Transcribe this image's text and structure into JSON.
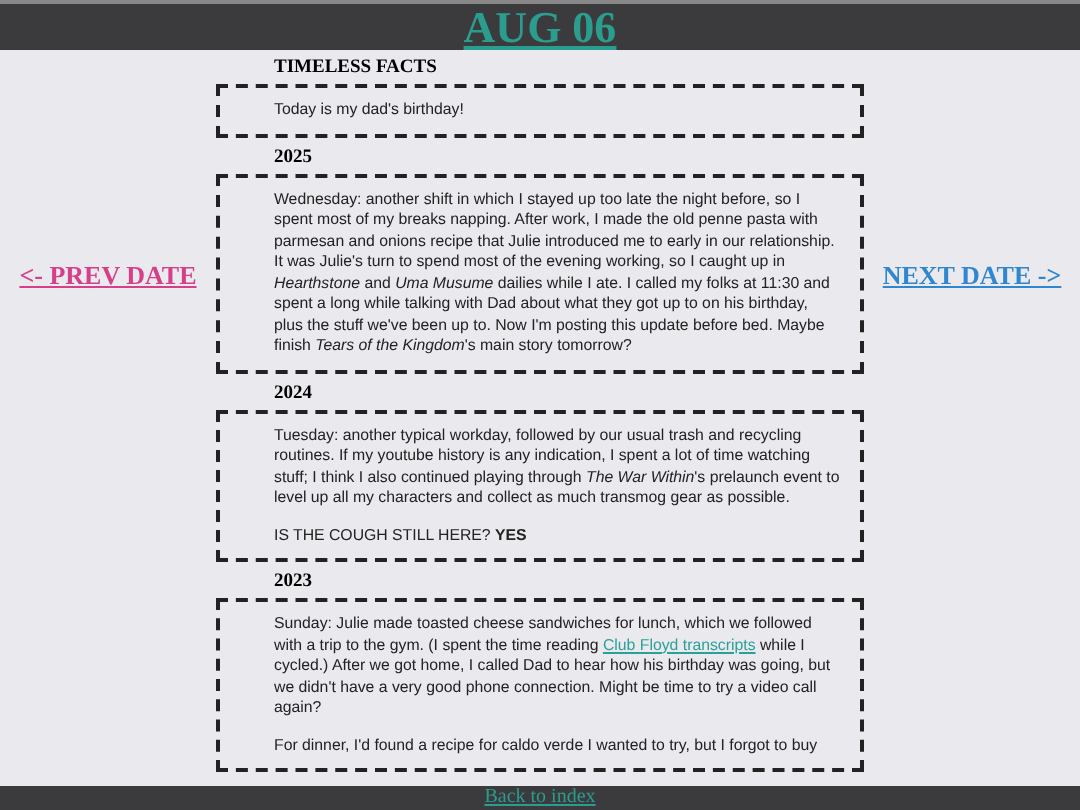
{
  "header": {
    "title": "AUG 06"
  },
  "nav": {
    "prev": "<- PREV DATE",
    "next": "NEXT DATE ->"
  },
  "sections": [
    {
      "heading": "TIMELESS FACTS",
      "paragraphs": [
        [
          {
            "kind": "text",
            "text": "Today is my dad's birthday!"
          }
        ]
      ]
    },
    {
      "heading": "2025",
      "paragraphs": [
        [
          {
            "kind": "text",
            "text": "Wednesday: another shift in which I stayed up too late the night before, so I spent most of my breaks napping. After work, I made the old penne pasta with parmesan and onions recipe that Julie introduced me to early in our relationship. It was Julie's turn to spend most of the evening working, so I caught up in *Hearthstone* and *Uma Musume* dailies while I ate. I called my folks at 11:30 and spent a long while talking with Dad about what they got up to on his birthday, plus the stuff we've been up to. Now I'm posting this update before bed. Maybe finish *Tears of the Kingdom*'s main story tomorrow?"
          }
        ]
      ]
    },
    {
      "heading": "2024",
      "paragraphs": [
        [
          {
            "kind": "text",
            "text": "Tuesday: another typical workday, followed by our usual trash and recycling routines. If my youtube history is any indication, I spent a lot of time watching stuff; I think I also continued playing through *The War Within*'s prelaunch event to level up all my characters and collect as much transmog gear as possible."
          }
        ],
        [
          {
            "kind": "text",
            "text": "IS THE COUGH STILL HERE? **YES**"
          }
        ]
      ]
    },
    {
      "heading": "2023",
      "paragraphs": [
        [
          {
            "kind": "text",
            "text": "Sunday: Julie made toasted cheese sandwiches for lunch, which we followed with a trip to the gym. (I spent the time reading "
          },
          {
            "kind": "link",
            "text": "Club Floyd transcripts"
          },
          {
            "kind": "text",
            "text": " while I cycled.) After we got home, I called Dad to hear how his birthday was going, but we didn't have a very good phone connection. Might be time to try a video call again?"
          }
        ],
        [
          {
            "kind": "text",
            "text": "For dinner, I'd found a recipe for caldo verde I wanted to try, but I forgot to buy"
          }
        ]
      ]
    }
  ],
  "footer": {
    "link": "Back to index"
  }
}
